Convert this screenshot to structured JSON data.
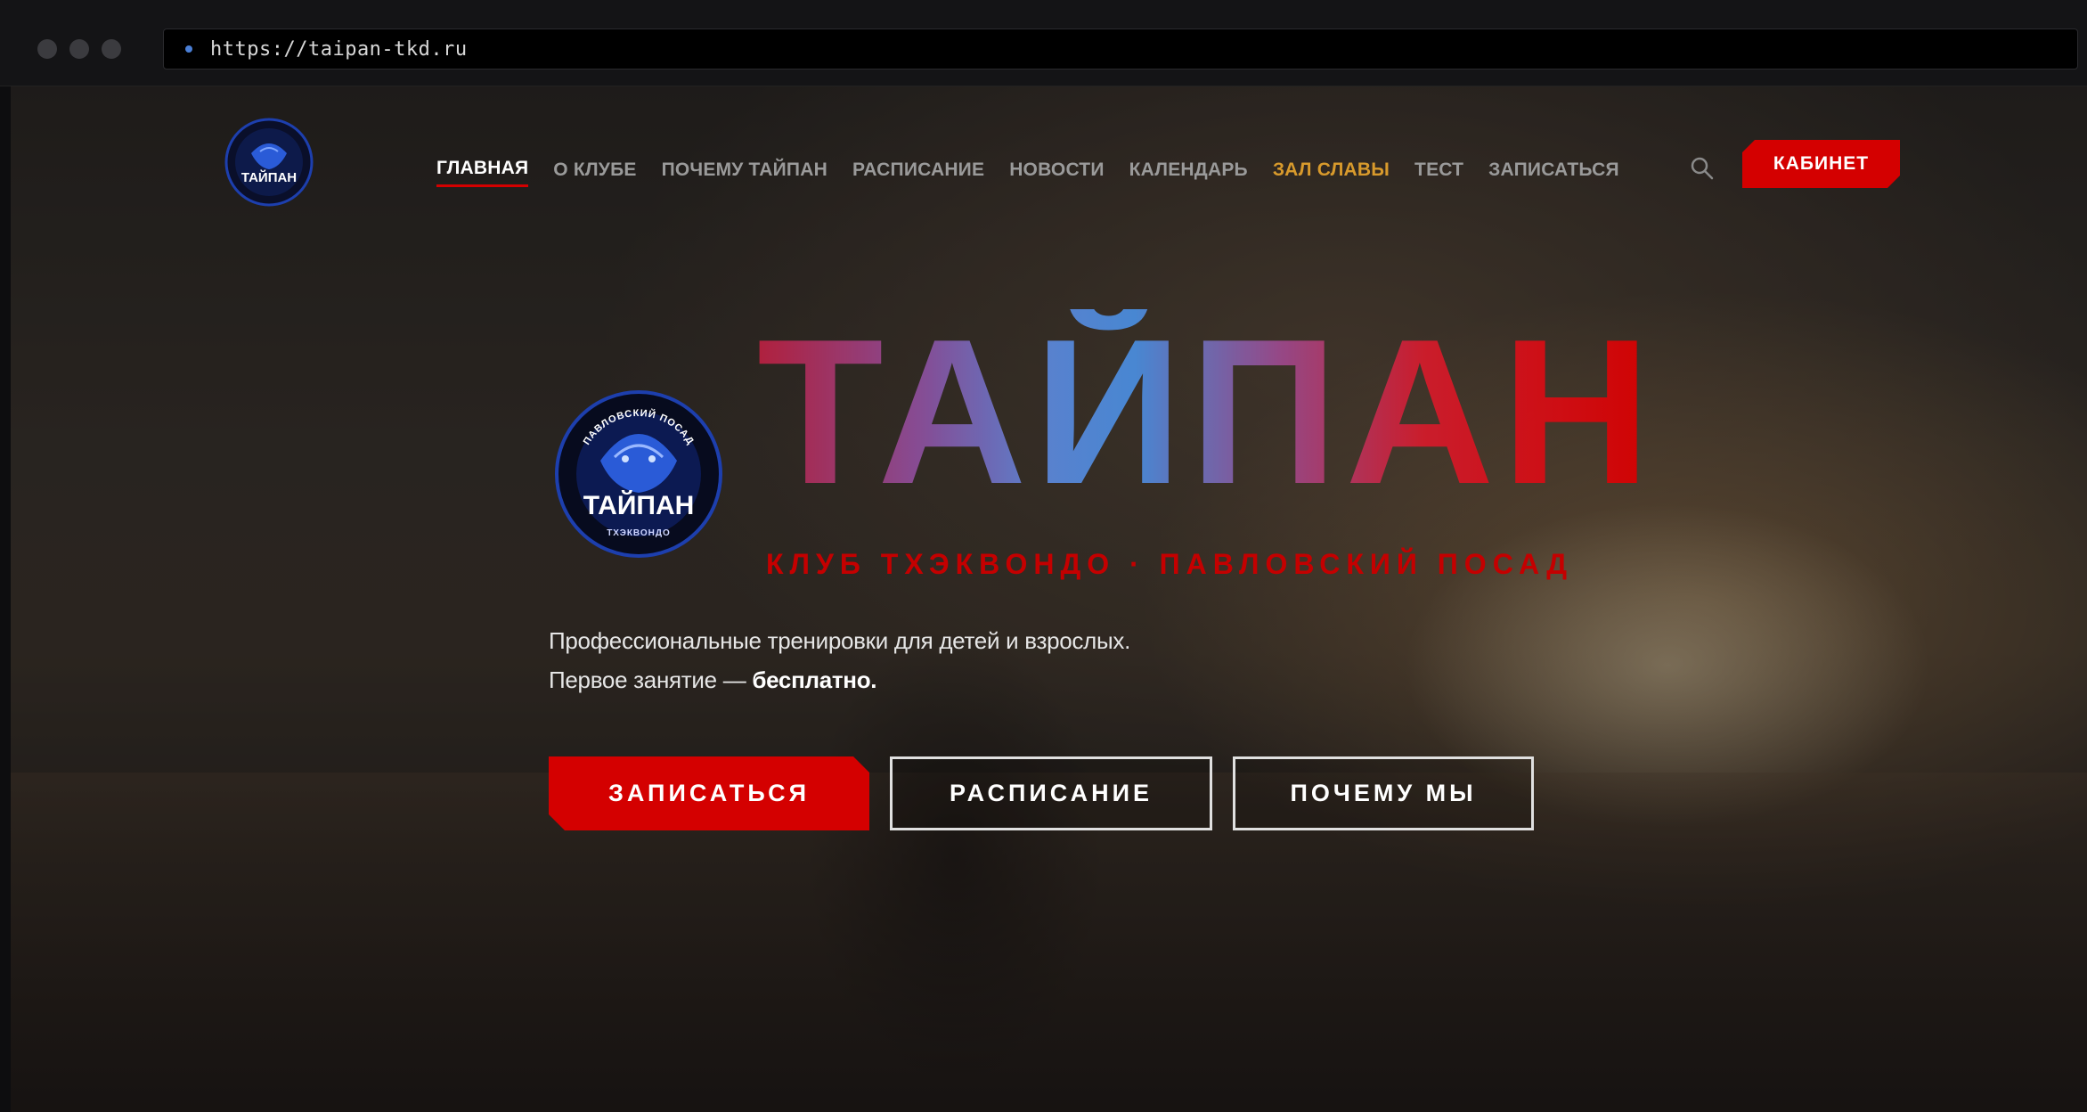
{
  "browser": {
    "url": "https://taipan-tkd.ru"
  },
  "nav": {
    "items": [
      {
        "label": "ГЛАВНАЯ",
        "state": "active"
      },
      {
        "label": "О КЛУБЕ",
        "state": ""
      },
      {
        "label": "ПОЧЕМУ ТАЙПАН",
        "state": ""
      },
      {
        "label": "РАСПИСАНИЕ",
        "state": ""
      },
      {
        "label": "НОВОСТИ",
        "state": ""
      },
      {
        "label": "КАЛЕНДАРЬ",
        "state": ""
      },
      {
        "label": "ЗАЛ СЛАВЫ",
        "state": "gold"
      },
      {
        "label": "ТЕСТ",
        "state": ""
      },
      {
        "label": "ЗАПИСАТЬСЯ",
        "state": ""
      }
    ],
    "cabinet_label": "КАБИНЕТ",
    "search_icon": "search-icon"
  },
  "logo": {
    "text": "ТАЙПАН",
    "ring_top": "ПАВЛОВСКИЙ ПОСАД",
    "ring_bottom": "ТХЭКВОНДО"
  },
  "hero": {
    "title": "ТАЙПАН",
    "subtitle": "КЛУБ ТХЭКВОНДО · ПАВЛОВСКИЙ ПОСАД",
    "line1": "Профессиональные тренировки для детей и взрослых.",
    "line2_prefix": "Первое занятие — ",
    "line2_bold": "бесплатно.",
    "buttons": {
      "signup": "ЗАПИСАТЬСЯ",
      "schedule": "РАСПИСАНИЕ",
      "why": "ПОЧЕМУ МЫ"
    }
  },
  "colors": {
    "accent_red": "#d40000",
    "gold": "#d89a2c",
    "logo_blue": "#2a5bd7"
  }
}
